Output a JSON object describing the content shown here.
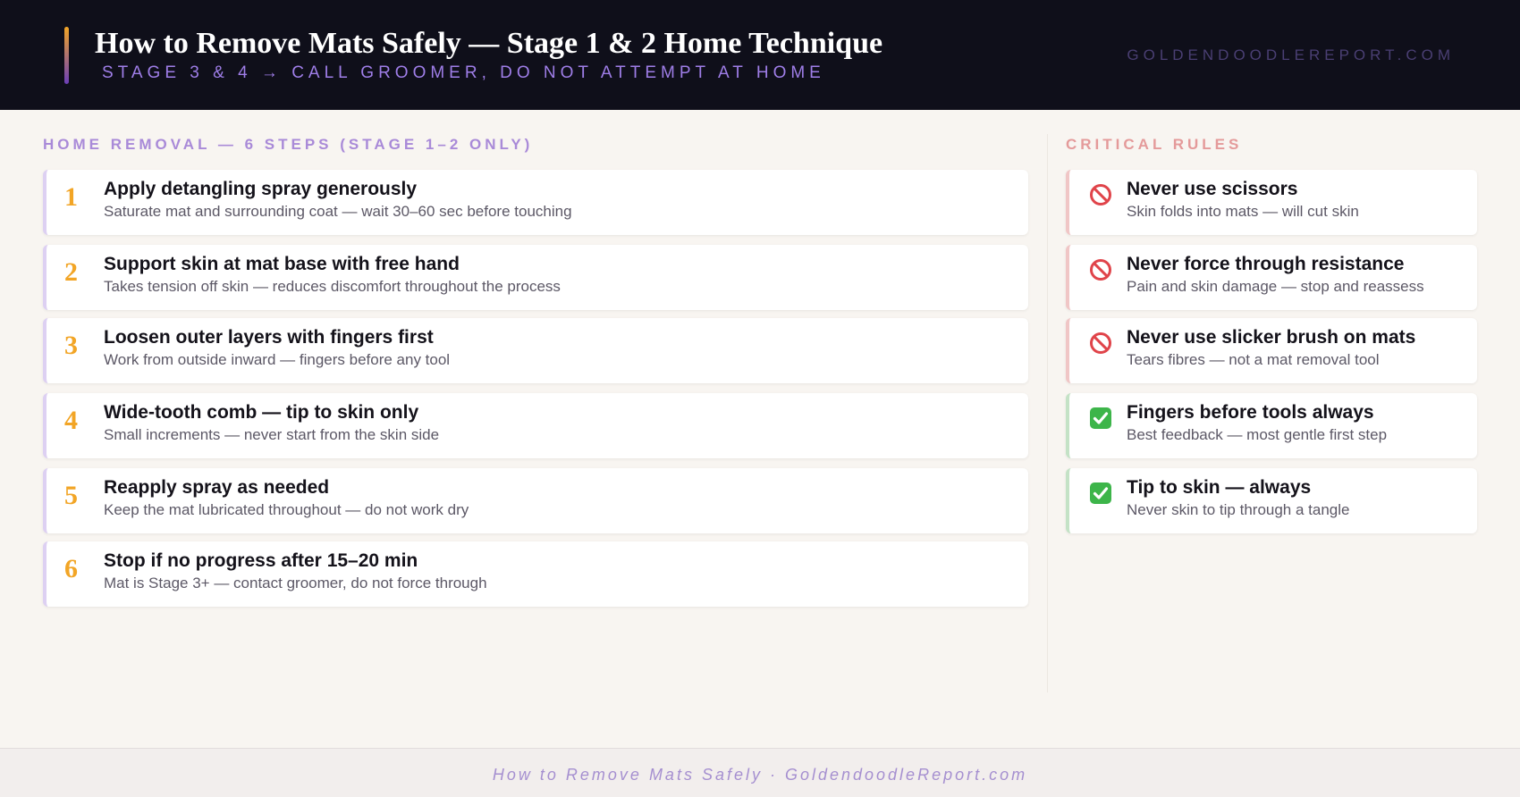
{
  "header": {
    "title": "How to Remove Mats Safely — Stage 1 & 2 Home Technique",
    "subtitle": "STAGE 3 & 4 → CALL GROOMER, DO NOT ATTEMPT AT HOME",
    "site": "GOLDENDOODLEREPORT.COM"
  },
  "steps": {
    "heading": "HOME REMOVAL — 6 STEPS (STAGE 1–2 ONLY)",
    "items": [
      {
        "number": "1",
        "title": "Apply detangling spray generously",
        "description": "Saturate mat and surrounding coat — wait 30–60 sec before touching"
      },
      {
        "number": "2",
        "title": "Support skin at mat base with free hand",
        "description": "Takes tension off skin — reduces discomfort throughout the process"
      },
      {
        "number": "3",
        "title": "Loosen outer layers with fingers first",
        "description": "Work from outside inward — fingers before any tool"
      },
      {
        "number": "4",
        "title": "Wide-tooth comb — tip to skin only",
        "description": "Small increments — never start from the skin side"
      },
      {
        "number": "5",
        "title": "Reapply spray as needed",
        "description": "Keep the mat lubricated throughout — do not work dry"
      },
      {
        "number": "6",
        "title": "Stop if no progress after 15–20 min",
        "description": "Mat is Stage 3+ — contact groomer, do not force through"
      }
    ]
  },
  "rules": {
    "heading": "CRITICAL RULES",
    "items": [
      {
        "icon": "prohibited-icon",
        "title": "Never use scissors",
        "description": "Skin folds into mats — will cut skin"
      },
      {
        "icon": "prohibited-icon",
        "title": "Never force through resistance",
        "description": "Pain and skin damage — stop and reassess"
      },
      {
        "icon": "prohibited-icon",
        "title": "Never use slicker brush on mats",
        "description": "Tears fibres — not a mat removal tool"
      },
      {
        "icon": "check-mark-icon",
        "title": "Fingers before tools always",
        "description": "Best feedback — most gentle first step"
      },
      {
        "icon": "check-mark-icon",
        "title": "Tip to skin — always",
        "description": "Never skin to tip through a tangle"
      }
    ]
  },
  "footer": {
    "text": "How to Remove Mats Safely · GoldendoodleReport.com"
  },
  "colors": {
    "header_bg": "#0f0f1a",
    "accent_orange": "#f2a526",
    "accent_purple": "#9f7ee8",
    "rule_bad": "#e0444a",
    "rule_good": "#3db54a"
  }
}
